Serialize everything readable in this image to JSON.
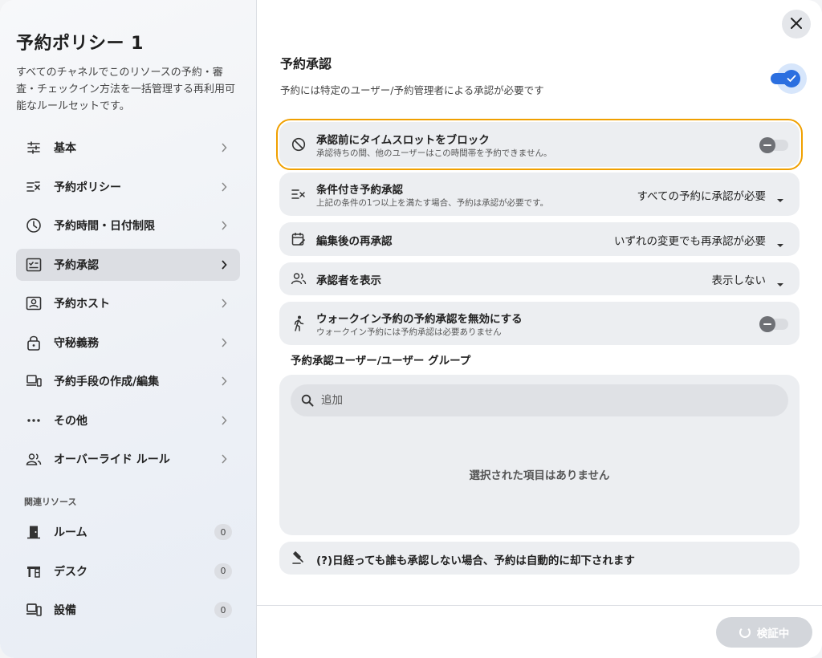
{
  "sidebar": {
    "title": "予約ポリシー 1",
    "description": "すべてのチャネルでこのリソースの予約・審査・チェックイン方法を一括管理する再利用可能なルールセットです。",
    "items": [
      {
        "label": "基本",
        "icon": "sliders-icon"
      },
      {
        "label": "予約ポリシー",
        "icon": "rule-list-icon"
      },
      {
        "label": "予約時間・日付制限",
        "icon": "clock-icon"
      },
      {
        "label": "予約承認",
        "icon": "approval-checklist-icon",
        "active": true
      },
      {
        "label": "予約ホスト",
        "icon": "host-badge-icon"
      },
      {
        "label": "守秘義務",
        "icon": "lock-icon"
      },
      {
        "label": "予約手段の作成/編集",
        "icon": "devices-icon"
      },
      {
        "label": "その他",
        "icon": "more-dots-icon"
      },
      {
        "label": "オーバーライド ルール",
        "icon": "people-icon"
      }
    ],
    "related_heading": "関連リソース",
    "related": [
      {
        "label": "ルーム",
        "count": "0",
        "icon": "door-icon"
      },
      {
        "label": "デスク",
        "count": "0",
        "icon": "desk-icon"
      },
      {
        "label": "設備",
        "count": "0",
        "icon": "equipment-icon"
      }
    ]
  },
  "main": {
    "title": "予約承認",
    "description": "予約には特定のユーザー/予約管理者による承認が必要です",
    "approval_enabled": true,
    "rows": {
      "block": {
        "title": "承認前にタイムスロットをブロック",
        "subtitle": "承認待ちの間、他のユーザーはこの時間帯を予約できません。",
        "enabled": false
      },
      "conditional": {
        "title": "条件付き予約承認",
        "subtitle": "上記の条件の1つ以上を満たす場合、予約は承認が必要です。",
        "value": "すべての予約に承認が必要"
      },
      "reapprove": {
        "title": "編集後の再承認",
        "value": "いずれの変更でも再承認が必要"
      },
      "show_approver": {
        "title": "承認者を表示",
        "value": "表示しない"
      },
      "walkin": {
        "title": "ウォークイン予約の予約承認を無効にする",
        "subtitle": "ウォークイン予約には予約承認は必要ありません",
        "enabled": false
      }
    },
    "group": {
      "heading": "予約承認ユーザー/ユーザー グループ",
      "search_placeholder": "追加",
      "empty_text": "選択された項目はありません"
    },
    "auto_reject": "(?)日経っても誰も承認しない場合、予約は自動的に却下されます",
    "footer": {
      "verify_label": "検証中"
    }
  },
  "colors": {
    "accent": "#2b6fe0",
    "focus_outline": "#f0a000",
    "row_bg": "#eceef1"
  }
}
